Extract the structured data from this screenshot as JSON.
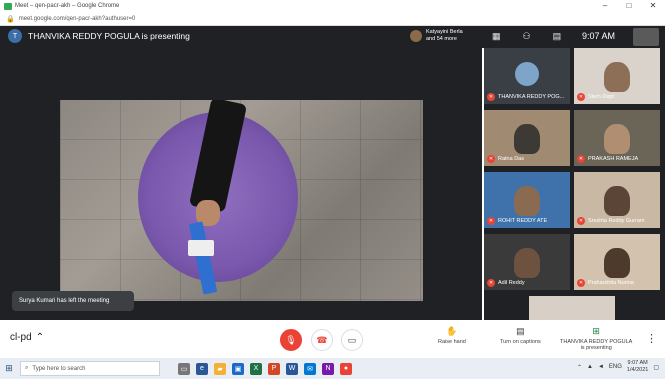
{
  "window": {
    "title": "Meet – qen-pacr-akh – Google Chrome",
    "controls": [
      "–",
      "□",
      "✕"
    ]
  },
  "address_bar": {
    "url": "meet.google.com/qen-pacr-akh?authuser=0"
  },
  "meet_header": {
    "presenter_initial": "T",
    "presenting_text": "THANVIKA REDDY POGULA is presenting",
    "viewers_line1": "Katyayini Berla",
    "viewers_line2": "and 54 more",
    "time": "9:07 AM",
    "icons": [
      "grid-icon",
      "people-icon",
      "chat-icon"
    ]
  },
  "toast": {
    "text": "Surya Kumari has left the meeting"
  },
  "participants": [
    {
      "name": "THANVIKA REDDY POG...",
      "tone": "#7ea4c9"
    },
    {
      "name": "Stem Dept",
      "tone": "#c9b7a0"
    },
    {
      "name": "Ratna Das",
      "tone": "#9a8a7a"
    },
    {
      "name": "PRAKASH RAMEJA",
      "tone": "#6d6a5e"
    },
    {
      "name": "ROHIT REDDY ATE",
      "tone": "#4d7fb8"
    },
    {
      "name": "Sreshta Reddy Gurram",
      "tone": "#b9a48f"
    },
    {
      "name": "Adil Reddy",
      "tone": "#4a4a4a"
    },
    {
      "name": "Praharshita Nunna",
      "tone": "#c7b19c"
    }
  ],
  "bottom_bar": {
    "meeting_code": "cl-pd",
    "raise_hand": "Raise hand",
    "captions": "Turn on captions",
    "presenting_line1": "THANVIKA REDDY POGULA",
    "presenting_line2": "is presenting"
  },
  "taskbar": {
    "search_placeholder": "Type here to search",
    "language": "ENG",
    "clock_time": "9:07 AM",
    "clock_date": "1/4/2021"
  },
  "colors": {
    "meet_dark": "#202124",
    "mic_red": "#ea4335",
    "present_green": "#188038"
  }
}
